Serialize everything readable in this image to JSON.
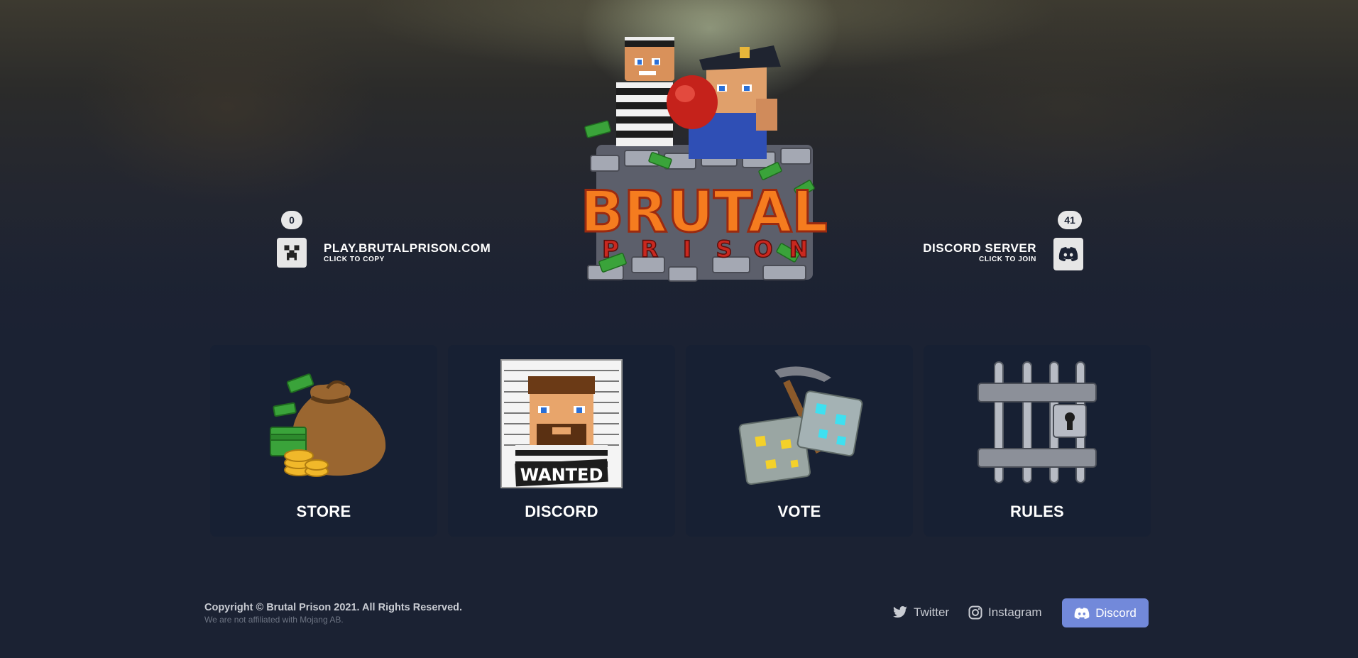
{
  "server": {
    "player_count": "0",
    "address": "PLAY.BRUTALPRISON.COM",
    "hint": "CLICK TO COPY",
    "icon": "creeper-icon"
  },
  "discord": {
    "member_count": "41",
    "title": "DISCORD SERVER",
    "hint": "CLICK TO JOIN",
    "icon": "discord-icon"
  },
  "logo": {
    "word1": "BRUTAL",
    "word2_letters": [
      "P",
      "R",
      "I",
      "S",
      "O",
      "N"
    ]
  },
  "cards": [
    {
      "label": "STORE",
      "icon": "money-bag-icon"
    },
    {
      "label": "DISCORD",
      "icon": "wanted-poster-icon"
    },
    {
      "label": "VOTE",
      "icon": "pickaxe-ore-icon"
    },
    {
      "label": "RULES",
      "icon": "jail-bars-icon"
    }
  ],
  "wanted_text": "WANTED",
  "footer": {
    "copyright": "Copyright © Brutal Prison 2021. All Rights Reserved.",
    "disclaimer": "We are not affiliated with Mojang AB.",
    "twitter": "Twitter",
    "instagram": "Instagram",
    "discord": "Discord"
  },
  "colors": {
    "background": "#1b2233",
    "card": "#172033",
    "discord_button": "#7289da",
    "logo_orange": "#f57c1f"
  }
}
